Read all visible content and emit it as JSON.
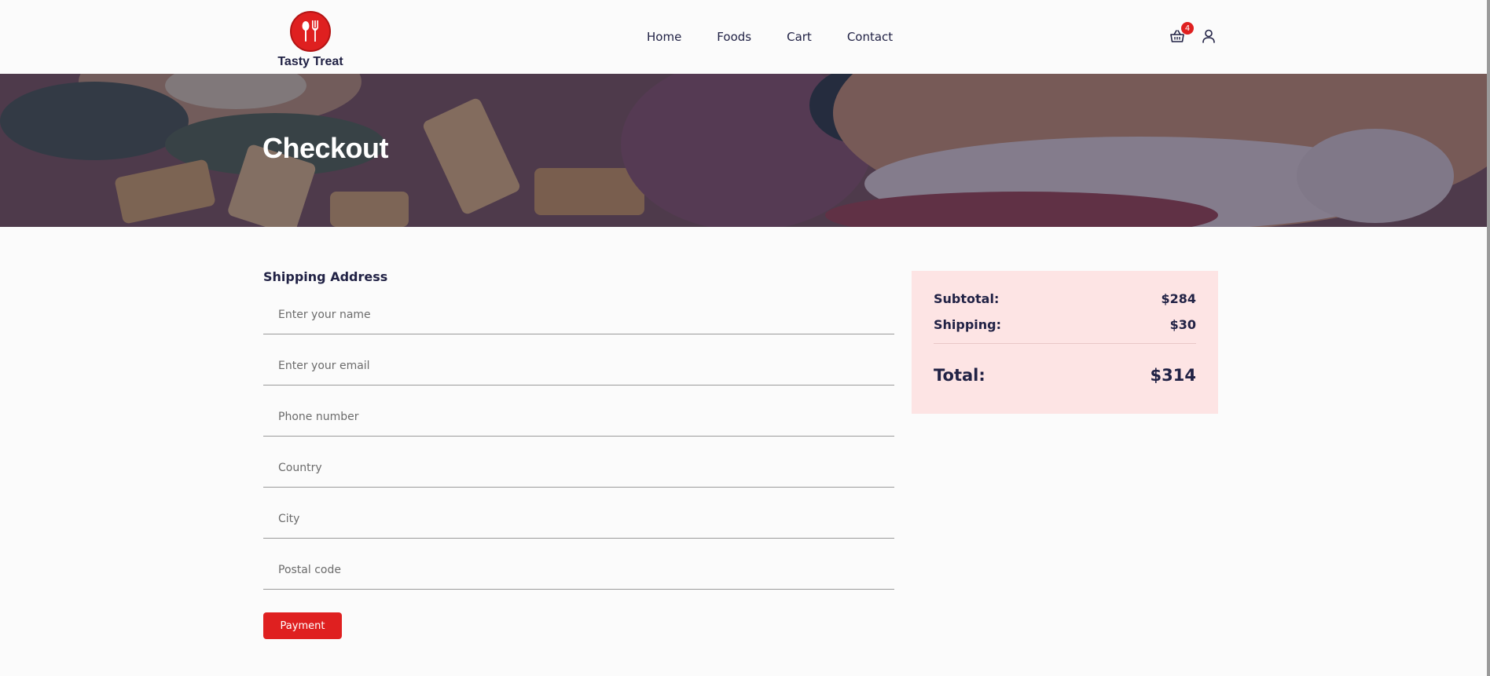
{
  "brand": {
    "name": "Tasty Treat"
  },
  "nav": {
    "items": [
      {
        "label": "Home"
      },
      {
        "label": "Foods"
      },
      {
        "label": "Cart"
      },
      {
        "label": "Contact"
      }
    ]
  },
  "header": {
    "cart_count": "4"
  },
  "hero": {
    "title": "Checkout"
  },
  "shipping": {
    "title": "Shipping Address",
    "fields": [
      {
        "placeholder": "Enter your name"
      },
      {
        "placeholder": "Enter your email"
      },
      {
        "placeholder": "Phone number"
      },
      {
        "placeholder": "Country"
      },
      {
        "placeholder": "City"
      },
      {
        "placeholder": "Postal code"
      }
    ],
    "submit_label": "Payment"
  },
  "summary": {
    "subtotal_label": "Subtotal:",
    "subtotal_value": "$284",
    "shipping_label": "Shipping:",
    "shipping_value": "$30",
    "total_label": "Total:",
    "total_value": "$314"
  },
  "colors": {
    "accent": "#df2020",
    "text": "#212245",
    "summary_bg": "#fde4e4",
    "page_bg": "#fbfbfb"
  },
  "icons": {
    "logo": "utensils-icon",
    "cart": "shopping-basket-icon",
    "user": "user-icon"
  }
}
